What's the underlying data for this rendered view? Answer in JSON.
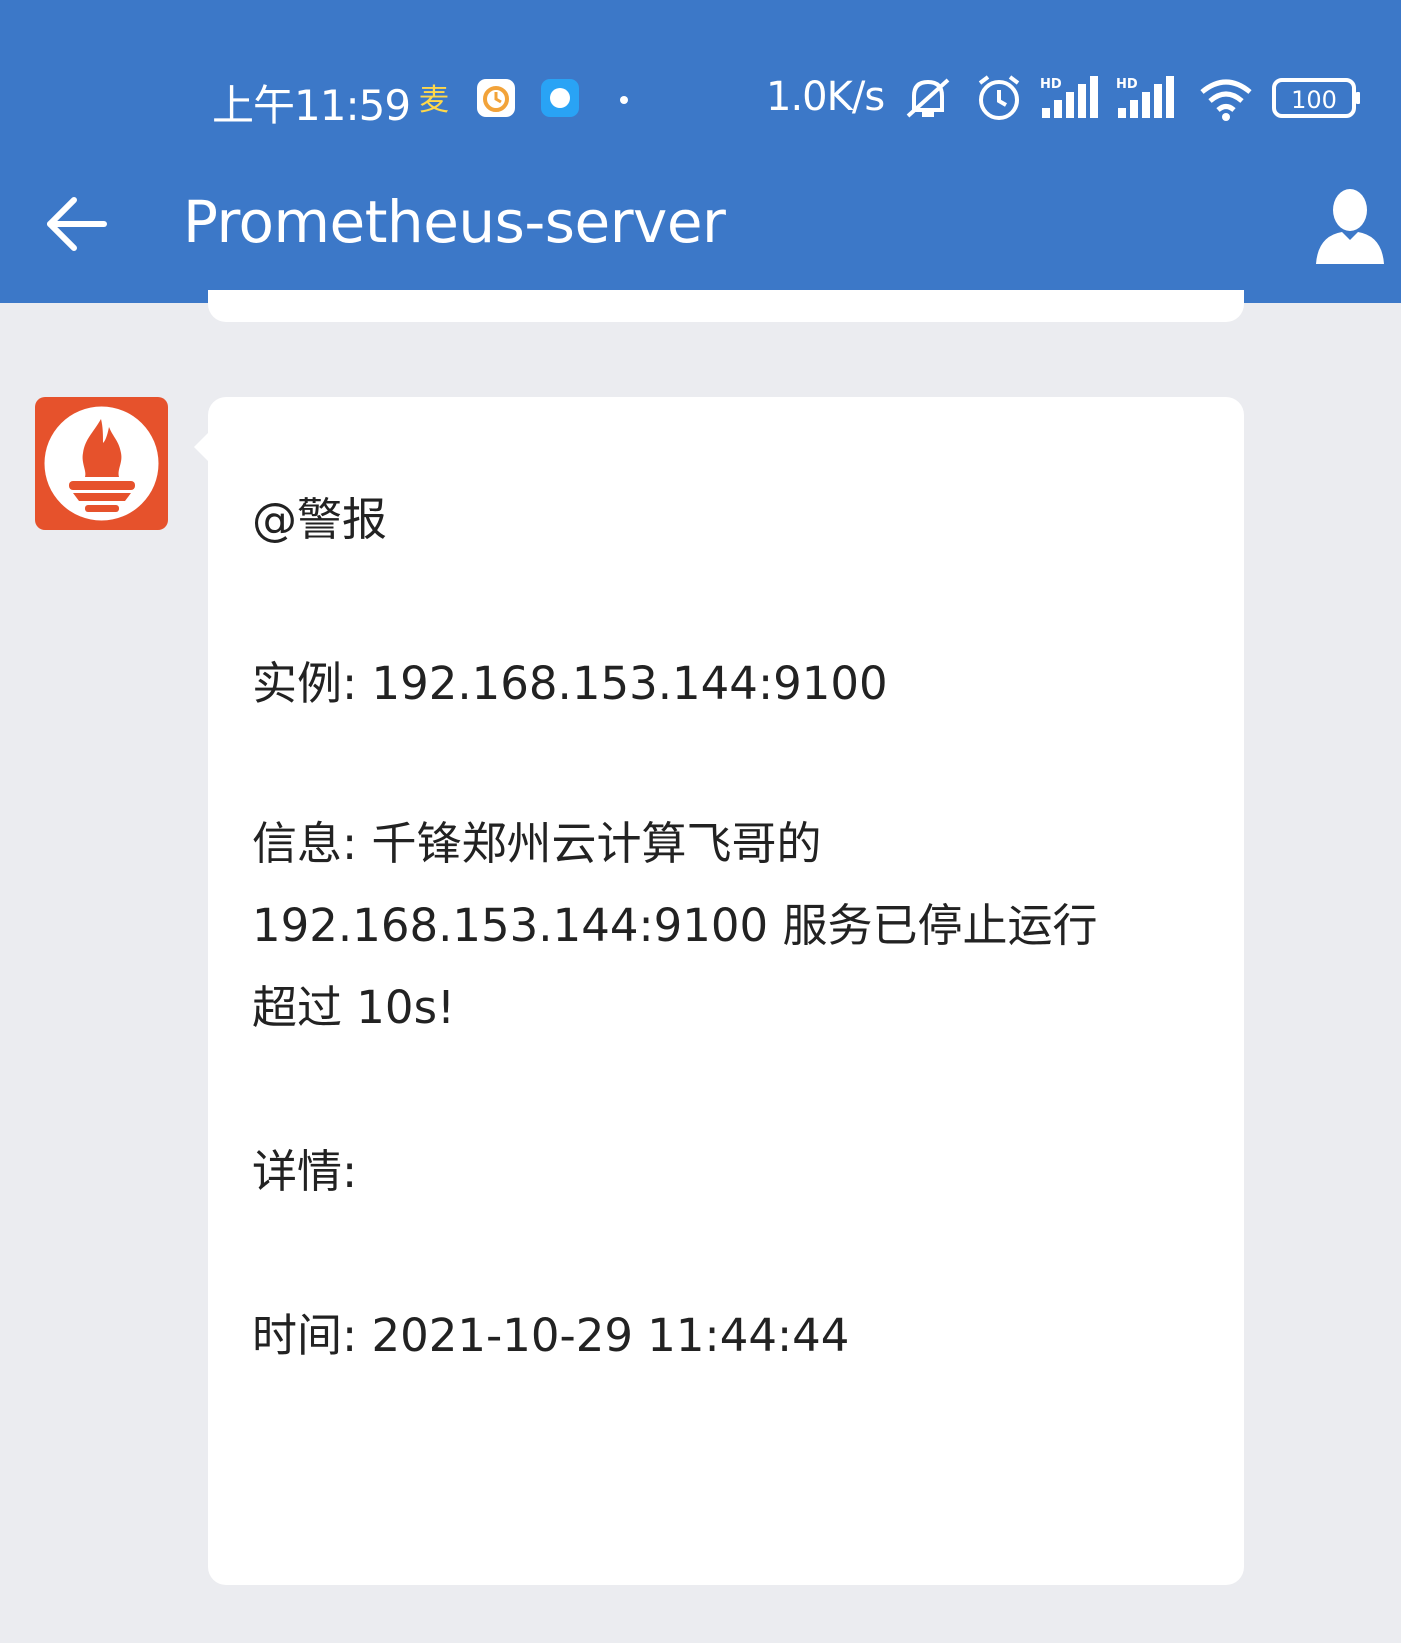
{
  "status_bar": {
    "time": "上午11:59",
    "network_speed": "1.0K/s",
    "battery": "100",
    "icons": [
      "app-notification-icon",
      "clock-app-icon",
      "chat-app-icon",
      "mute-icon",
      "alarm-icon",
      "signal-hd-icon",
      "signal-hd-icon",
      "wifi-icon",
      "battery-icon"
    ]
  },
  "header": {
    "title": "Prometheus-server",
    "back_icon": "arrow-left-icon",
    "profile_icon": "person-icon"
  },
  "message": {
    "sender_avatar": "prometheus-logo",
    "mention": "@警报",
    "instance_line": "实例: 192.168.153.144:9100",
    "info_line1": "信息: 千锋郑州云计算飞哥的",
    "info_line2": "192.168.153.144:9100 服务已停止运行",
    "info_line3": "超过 10s!",
    "details": "详情:",
    "time_line": "时间: 2021-10-29 11:44:44"
  },
  "colors": {
    "header_bg": "#3c78c8",
    "page_bg": "#ebecf0",
    "avatar_bg": "#e6522c"
  }
}
